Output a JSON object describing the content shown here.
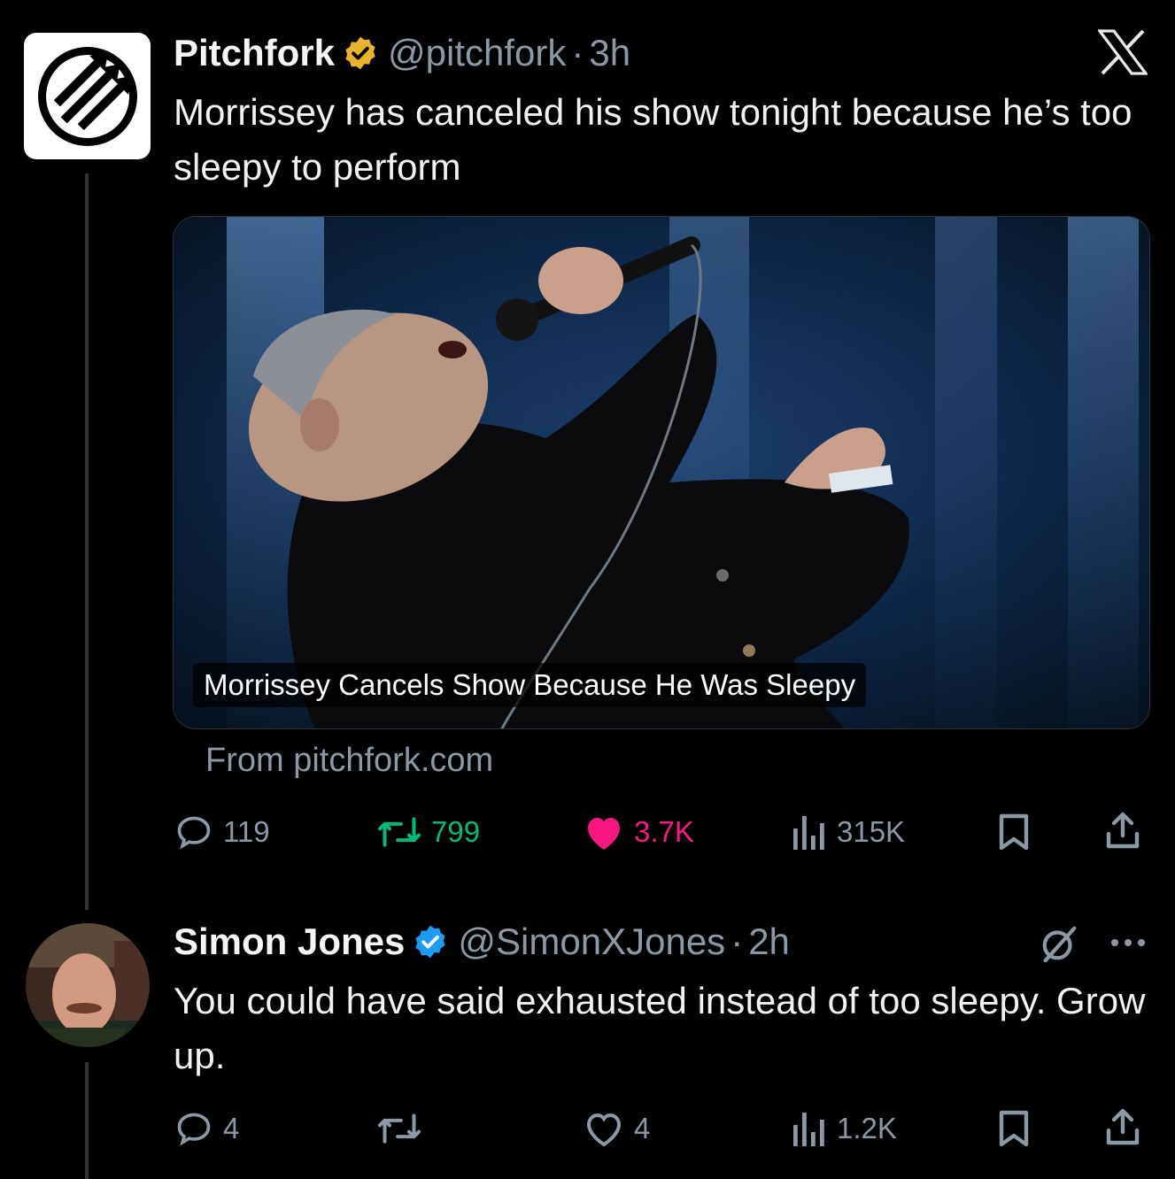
{
  "tweet": {
    "author_name": "Pitchfork",
    "handle": "@pitchfork",
    "separator": "·",
    "time": "3h",
    "text": "Morrissey has canceled his show tonight because he’s too sleepy to perform",
    "card": {
      "headline": "Morrissey Cancels Show Because He Was Sleepy",
      "source": "From pitchfork.com"
    },
    "stats": {
      "replies": "119",
      "reposts": "799",
      "likes": "3.7K",
      "views": "315K"
    }
  },
  "reply": {
    "author_name": "Simon Jones",
    "handle": "@SimonXJones",
    "separator": "·",
    "time": "2h",
    "text": "You could have said exhausted instead of too sleepy. Grow up.",
    "stats": {
      "replies": "4",
      "reposts": "",
      "likes": "4",
      "views": "1.2K"
    }
  },
  "colors": {
    "background": "#000000",
    "verified_gold": "#e8b32e",
    "verified_blue": "#1d9bf0",
    "repost_green": "#00ba7c",
    "like_pink": "#f91880",
    "secondary_text": "#8b98a5"
  },
  "icons": [
    "x-logo-icon",
    "verified-badge-icon",
    "reply-icon",
    "repost-icon",
    "heart-icon",
    "views-icon",
    "bookmark-icon",
    "share-icon",
    "grok-icon",
    "more-icon"
  ]
}
